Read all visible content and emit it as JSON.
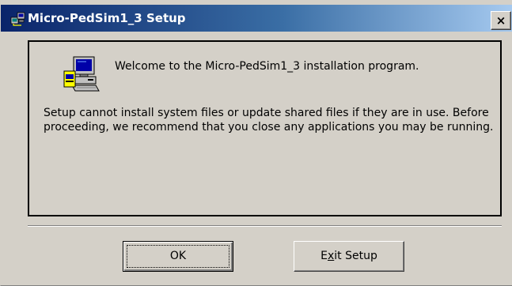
{
  "window": {
    "title": "Micro-PedSim1_3 Setup",
    "close_glyph": "×",
    "title_icon": "setup-computer-icon"
  },
  "content": {
    "welcome": "Welcome to the Micro-PedSim1_3 installation program.",
    "warning": "Setup cannot install system files or update shared files if they are in use. Before proceeding, we recommend that you close any applications you may be running.",
    "icon": "setup-computer-icon"
  },
  "buttons": {
    "ok_label": "OK",
    "exit_label_before": "E",
    "exit_label_accel": "x",
    "exit_label_after": "it Setup"
  },
  "colors": {
    "title_start": "#0a246a",
    "title_end": "#a6caf0",
    "face": "#d4d0c8"
  }
}
